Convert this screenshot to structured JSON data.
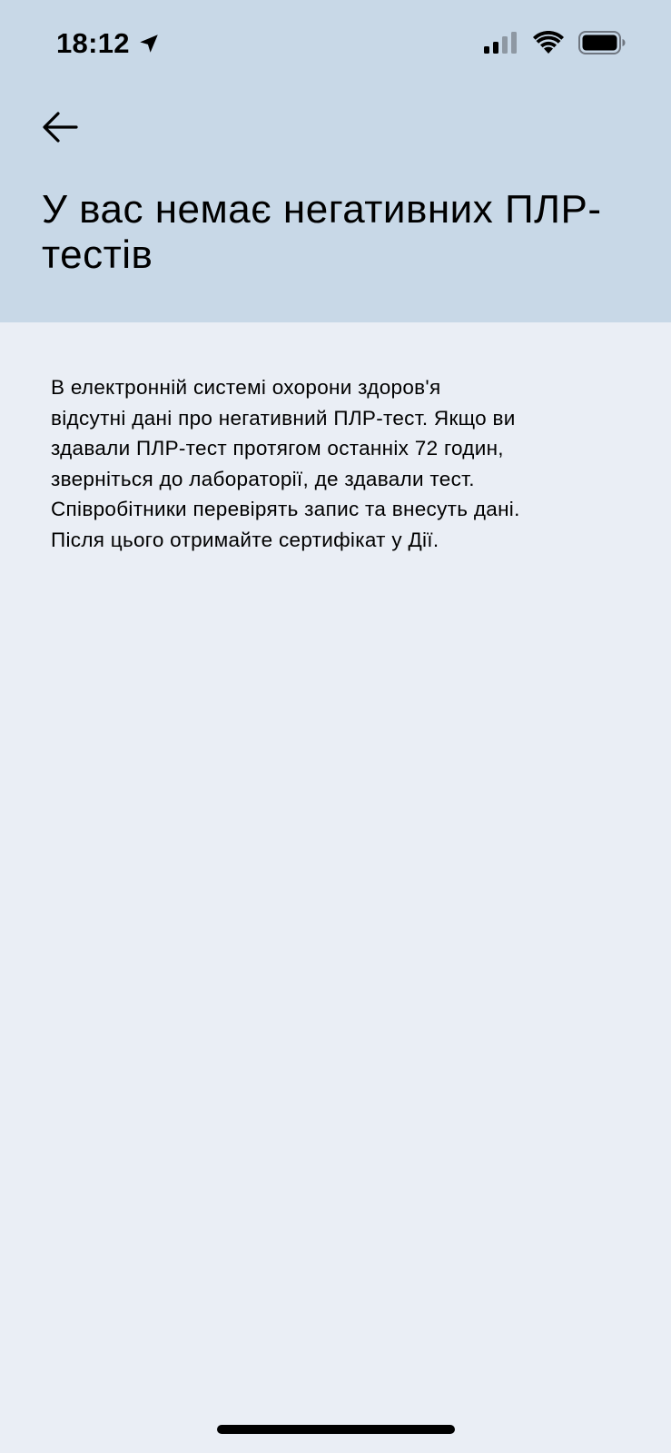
{
  "status_bar": {
    "time": "18:12",
    "icons": [
      "location-arrow-icon",
      "cellular-signal-icon",
      "wifi-icon",
      "battery-icon"
    ]
  },
  "header": {
    "back_icon": "arrow-left-icon",
    "title": "У вас немає негативних ПЛР-тестів",
    "background_color": "#c8d8e7"
  },
  "content": {
    "lines": [
      "В електронній системі охорони здоров'я",
      "відсутні дані про негативний ПЛР-тест. Якщо ви",
      "здавали ПЛР-тест протягом останніх 72 годин,",
      "зверніться до лабораторії, де здавали тест.",
      "Співробітники перевірять запис та внесуть дані.",
      "Після цього отримайте сертифікат у Дії."
    ],
    "background_color": "#eaeef5"
  }
}
